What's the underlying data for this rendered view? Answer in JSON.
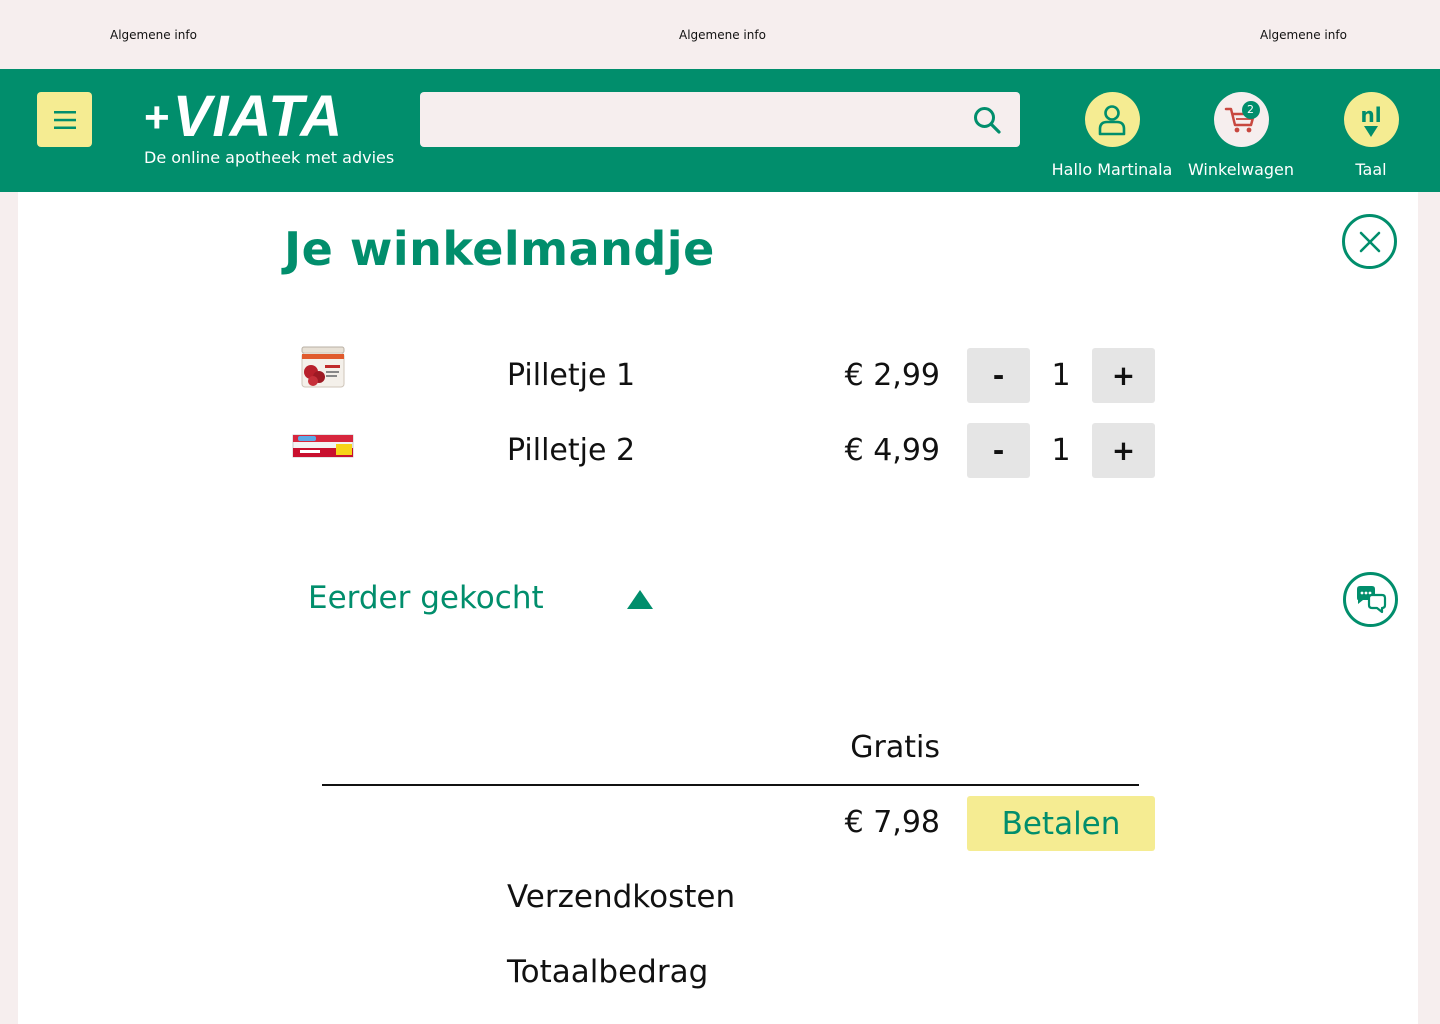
{
  "topbar": {
    "items": [
      "Algemene info",
      "Algemene info",
      "Algemene info"
    ]
  },
  "header": {
    "brand": "VIATA",
    "brand_prefix": "+",
    "tagline": "De online apotheek met advies",
    "search": {
      "value": "",
      "placeholder": ""
    },
    "user_label": "Hallo Martinala",
    "cart_label": "Winkelwagen",
    "cart_count": "2",
    "lang_label": "Taal",
    "lang_code": "nl"
  },
  "cart": {
    "title": "Je winkelmandje",
    "items": [
      {
        "name": "Pilletje 1",
        "price": "€ 2,99",
        "qty": "1",
        "minus": "-",
        "plus": "+"
      },
      {
        "name": "Pilletje 2",
        "price": "€ 4,99",
        "qty": "1",
        "minus": "-",
        "plus": "+"
      }
    ],
    "previously_bought": "Eerder gekocht",
    "shipping_value": "Gratis",
    "total_value": "€ 7,98",
    "pay_label": "Betalen",
    "shipping_label": "Verzendkosten",
    "total_label": "Totaalbedrag"
  },
  "colors": {
    "brand_green": "#018e6c",
    "accent_yellow": "#f5ec92",
    "background": "#f6eeee",
    "cart_icon": "#c8473f"
  },
  "icons": [
    "menu-icon",
    "search-icon",
    "user-icon",
    "cart-icon",
    "close-icon",
    "chat-icon",
    "caret-up-icon"
  ]
}
